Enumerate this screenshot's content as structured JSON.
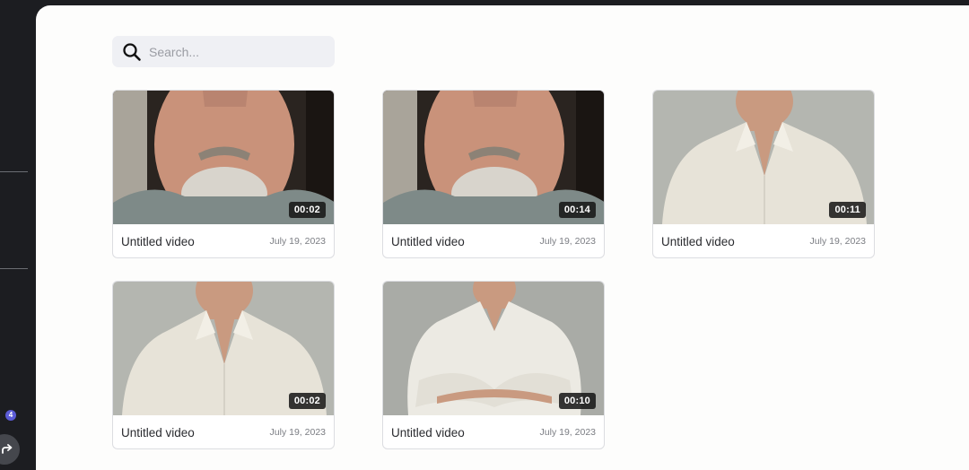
{
  "sidebar": {
    "badge_count": "4"
  },
  "search": {
    "placeholder": "Search..."
  },
  "videos": [
    {
      "title": "Untitled video",
      "date": "July 19, 2023",
      "duration": "00:02",
      "thumbnail": "older-man-portrait"
    },
    {
      "title": "Untitled video",
      "date": "July 19, 2023",
      "duration": "00:14",
      "thumbnail": "older-man-portrait"
    },
    {
      "title": "Untitled video",
      "date": "July 19, 2023",
      "duration": "00:11",
      "thumbnail": "young-man-white-shirt"
    },
    {
      "title": "Untitled video",
      "date": "July 19, 2023",
      "duration": "00:02",
      "thumbnail": "young-man-white-shirt"
    },
    {
      "title": "Untitled video",
      "date": "July 19, 2023",
      "duration": "00:10",
      "thumbnail": "man-arms-crossed"
    }
  ],
  "colors": {
    "sidebar_bg": "#1c1d21",
    "panel_bg": "#fdfdfc",
    "search_bg": "#eff0f4",
    "badge": "#5b5bd6"
  }
}
